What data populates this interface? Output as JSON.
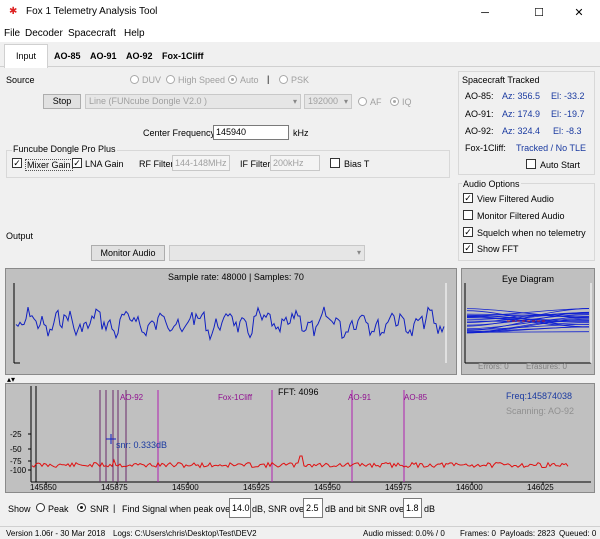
{
  "window": {
    "title": "Fox 1 Telemetry Analysis Tool",
    "min": "─",
    "max": "☐",
    "close": "✕",
    "icon": "✱"
  },
  "menu": [
    "File",
    "Decoder",
    "Spacecraft",
    "Help"
  ],
  "tabs": [
    "Input",
    "AO-85",
    "AO-91",
    "AO-92",
    "Fox-1Cliff"
  ],
  "source": {
    "label": "Source",
    "modes": [
      "DUV",
      "High Speed",
      "Auto"
    ],
    "mode_sep": "|",
    "psk": "PSK",
    "stop": "Stop",
    "device": "Line (FUNcube Dongle V2.0  )",
    "rate": "192000",
    "af": "AF",
    "iq": "IQ",
    "center_label": "Center Frequency",
    "center_value": "145940",
    "center_unit": "kHz"
  },
  "funcube": {
    "title": "Funcube Dongle Pro Plus",
    "mixer_gain": "Mixer Gain",
    "lna_gain": "LNA Gain",
    "rf_filter_label": "RF Filter",
    "rf_filter_value": "144-148MHz",
    "if_filter_label": "IF Filter",
    "if_filter_value": "200kHz",
    "bias_t": "Bias T"
  },
  "output": {
    "label": "Output",
    "monitor": "Monitor Audio"
  },
  "tracked": {
    "title": "Spacecraft Tracked",
    "rows": [
      {
        "name": "AO-85:",
        "az": "Az: 356.5",
        "el": "El: -33.2"
      },
      {
        "name": "AO-91:",
        "az": "Az: 174.9",
        "el": "El: -19.7"
      },
      {
        "name": "AO-92:",
        "az": "Az: 324.4",
        "el": "El: -8.3"
      }
    ],
    "cliff_name": "Fox-1Cliff:",
    "cliff_status": "Tracked / No TLE",
    "auto_start": "Auto Start"
  },
  "audio_options": {
    "title": "Audio Options",
    "items": [
      "View Filtered Audio",
      "Monitor Filtered Audio",
      "Squelch when no telemetry",
      "Show FFT"
    ],
    "checked": [
      true,
      false,
      true,
      true
    ]
  },
  "audio_panel": {
    "caption": "Sample rate: 48000 | Samples: 70"
  },
  "eye": {
    "title": "Eye Diagram",
    "errors": "Errors: 0",
    "erasures": "Erasures: 0"
  },
  "fft": {
    "title": "FFT: 4096",
    "freq": "Freq:145874038",
    "scanning": "Scanning: AO-92",
    "snr": "snr: 0.333dB",
    "yticks": [
      "-25",
      "-50",
      "-75",
      "-100"
    ],
    "xticks": [
      "145850",
      "145875",
      "145900",
      "145925",
      "145950",
      "145975",
      "146000",
      "146025"
    ],
    "markers": [
      "AO-92",
      "Fox-1Cliff",
      "AO-91",
      "AO-85"
    ]
  },
  "bottom": {
    "show": "Show",
    "peak": "Peak",
    "snr": "SNR",
    "sep": "|",
    "find1": "Find Signal when peak over",
    "v1": "14.0",
    "find2": "dB, SNR over",
    "v2": "2.5",
    "find3": "dB and bit SNR over",
    "v3": "1.8",
    "find4": "dB"
  },
  "status": {
    "version": "Version 1.06r - 30 Mar 2018",
    "logs": "Logs: C:\\Users\\chris\\Desktop\\Test\\DEV2",
    "missed": "Audio missed: 0.0% / 0",
    "frames": "Frames: 0",
    "payloads": "Payloads: 2823",
    "queued": "Queued: 0"
  },
  "colors": {
    "audio_trace": "#1020c0",
    "fft_trace": "#e01010",
    "marker": "#b020b0",
    "panel_bg": "#c0c0c0"
  }
}
